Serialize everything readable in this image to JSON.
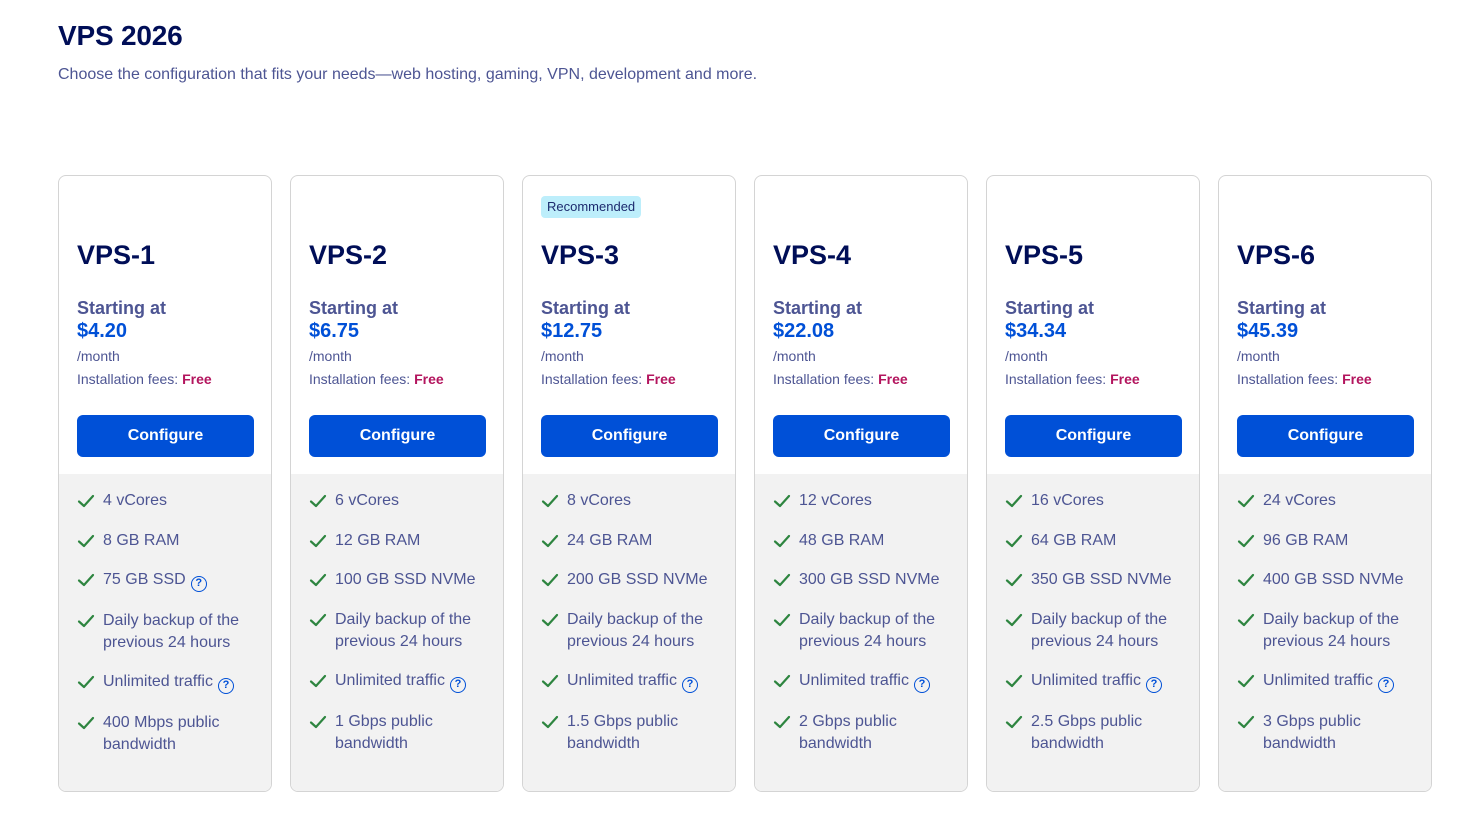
{
  "header": {
    "title": "VPS 2026",
    "subtitle": "Choose the configuration that fits your needs—web hosting, gaming, VPN, development and more."
  },
  "labels": {
    "starting_at": "Starting at",
    "per_month": "/month",
    "installation_fees": "Installation fees: ",
    "free": "Free",
    "configure": "Configure",
    "help_glyph": "?"
  },
  "colors": {
    "primary_blue": "#0050d7",
    "dark_navy": "#000e57",
    "muted_text": "#4d5593",
    "free_accent": "#b3155e",
    "check_green": "#2e8540",
    "badge_bg": "#bdeefb",
    "feature_bg": "#f2f2f2"
  },
  "plans": [
    {
      "name": "VPS-1",
      "badge": "",
      "price": "$4.20",
      "features": [
        {
          "text": "4 vCores",
          "help": false
        },
        {
          "text": "8 GB RAM",
          "help": false
        },
        {
          "text": "75 GB SSD",
          "help": true
        },
        {
          "text": "Daily backup of the previous 24 hours",
          "help": false
        },
        {
          "text": "Unlimited traffic",
          "help": true
        },
        {
          "text": "400 Mbps public bandwidth",
          "help": false
        }
      ]
    },
    {
      "name": "VPS-2",
      "badge": "",
      "price": "$6.75",
      "features": [
        {
          "text": "6 vCores",
          "help": false
        },
        {
          "text": "12 GB RAM",
          "help": false
        },
        {
          "text": "100 GB SSD NVMe",
          "help": false
        },
        {
          "text": "Daily backup of the previous 24 hours",
          "help": false
        },
        {
          "text": "Unlimited traffic",
          "help": true
        },
        {
          "text": "1 Gbps public bandwidth",
          "help": false
        }
      ]
    },
    {
      "name": "VPS-3",
      "badge": "Recommended",
      "price": "$12.75",
      "features": [
        {
          "text": "8 vCores",
          "help": false
        },
        {
          "text": "24 GB RAM",
          "help": false
        },
        {
          "text": "200 GB SSD NVMe",
          "help": false
        },
        {
          "text": "Daily backup of the previous 24 hours",
          "help": false
        },
        {
          "text": "Unlimited traffic",
          "help": true
        },
        {
          "text": "1.5 Gbps public bandwidth",
          "help": false
        }
      ]
    },
    {
      "name": "VPS-4",
      "badge": "",
      "price": "$22.08",
      "features": [
        {
          "text": "12 vCores",
          "help": false
        },
        {
          "text": "48 GB RAM",
          "help": false
        },
        {
          "text": "300 GB SSD NVMe",
          "help": false
        },
        {
          "text": "Daily backup of the previous 24 hours",
          "help": false
        },
        {
          "text": "Unlimited traffic",
          "help": true
        },
        {
          "text": "2 Gbps public bandwidth",
          "help": false
        }
      ]
    },
    {
      "name": "VPS-5",
      "badge": "",
      "price": "$34.34",
      "features": [
        {
          "text": "16 vCores",
          "help": false
        },
        {
          "text": "64 GB RAM",
          "help": false
        },
        {
          "text": "350 GB SSD NVMe",
          "help": false
        },
        {
          "text": "Daily backup of the previous 24 hours",
          "help": false
        },
        {
          "text": "Unlimited traffic",
          "help": true
        },
        {
          "text": "2.5 Gbps public bandwidth",
          "help": false
        }
      ]
    },
    {
      "name": "VPS-6",
      "badge": "",
      "price": "$45.39",
      "features": [
        {
          "text": "24 vCores",
          "help": false
        },
        {
          "text": "96 GB RAM",
          "help": false
        },
        {
          "text": "400 GB SSD NVMe",
          "help": false
        },
        {
          "text": "Daily backup of the previous 24 hours",
          "help": false
        },
        {
          "text": "Unlimited traffic",
          "help": true
        },
        {
          "text": "3 Gbps public bandwidth",
          "help": false
        }
      ]
    }
  ]
}
